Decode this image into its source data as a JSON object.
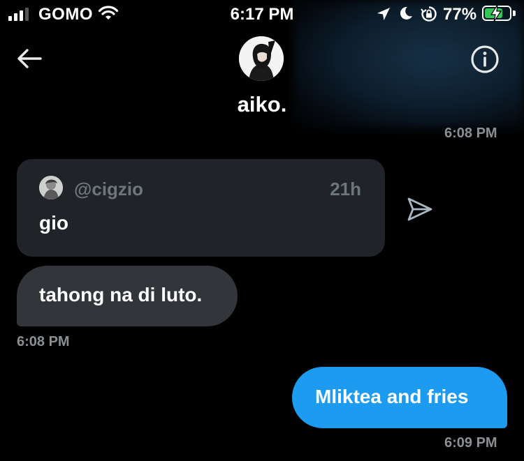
{
  "status_bar": {
    "carrier": "GOMO",
    "time": "6:17 PM",
    "battery_percent": "77%",
    "battery_level": 0.77,
    "icons": [
      "signal-icon",
      "wifi-icon",
      "location-arrow-icon",
      "moon-icon",
      "rotation-lock-icon",
      "battery-charging-icon"
    ]
  },
  "header": {
    "back_icon": "arrow-left-icon",
    "contact_name": "aiko.",
    "info_icon": "info-icon"
  },
  "messages": {
    "top_timestamp": "6:08 PM",
    "shared_post": {
      "handle": "@cigzio",
      "age": "21h",
      "text": "gio",
      "share_icon": "send-icon"
    },
    "received": {
      "text": "tahong na di luto.",
      "timestamp": "6:08 PM"
    },
    "sent": {
      "text": "Mliktea and fries",
      "timestamp": "6:09 PM"
    }
  },
  "colors": {
    "background": "#000000",
    "sent_bubble": "#1d9bf0",
    "received_bubble": "#323539",
    "card": "#202327",
    "muted_text": "#8b8f94",
    "battery_fill": "#34c759"
  }
}
